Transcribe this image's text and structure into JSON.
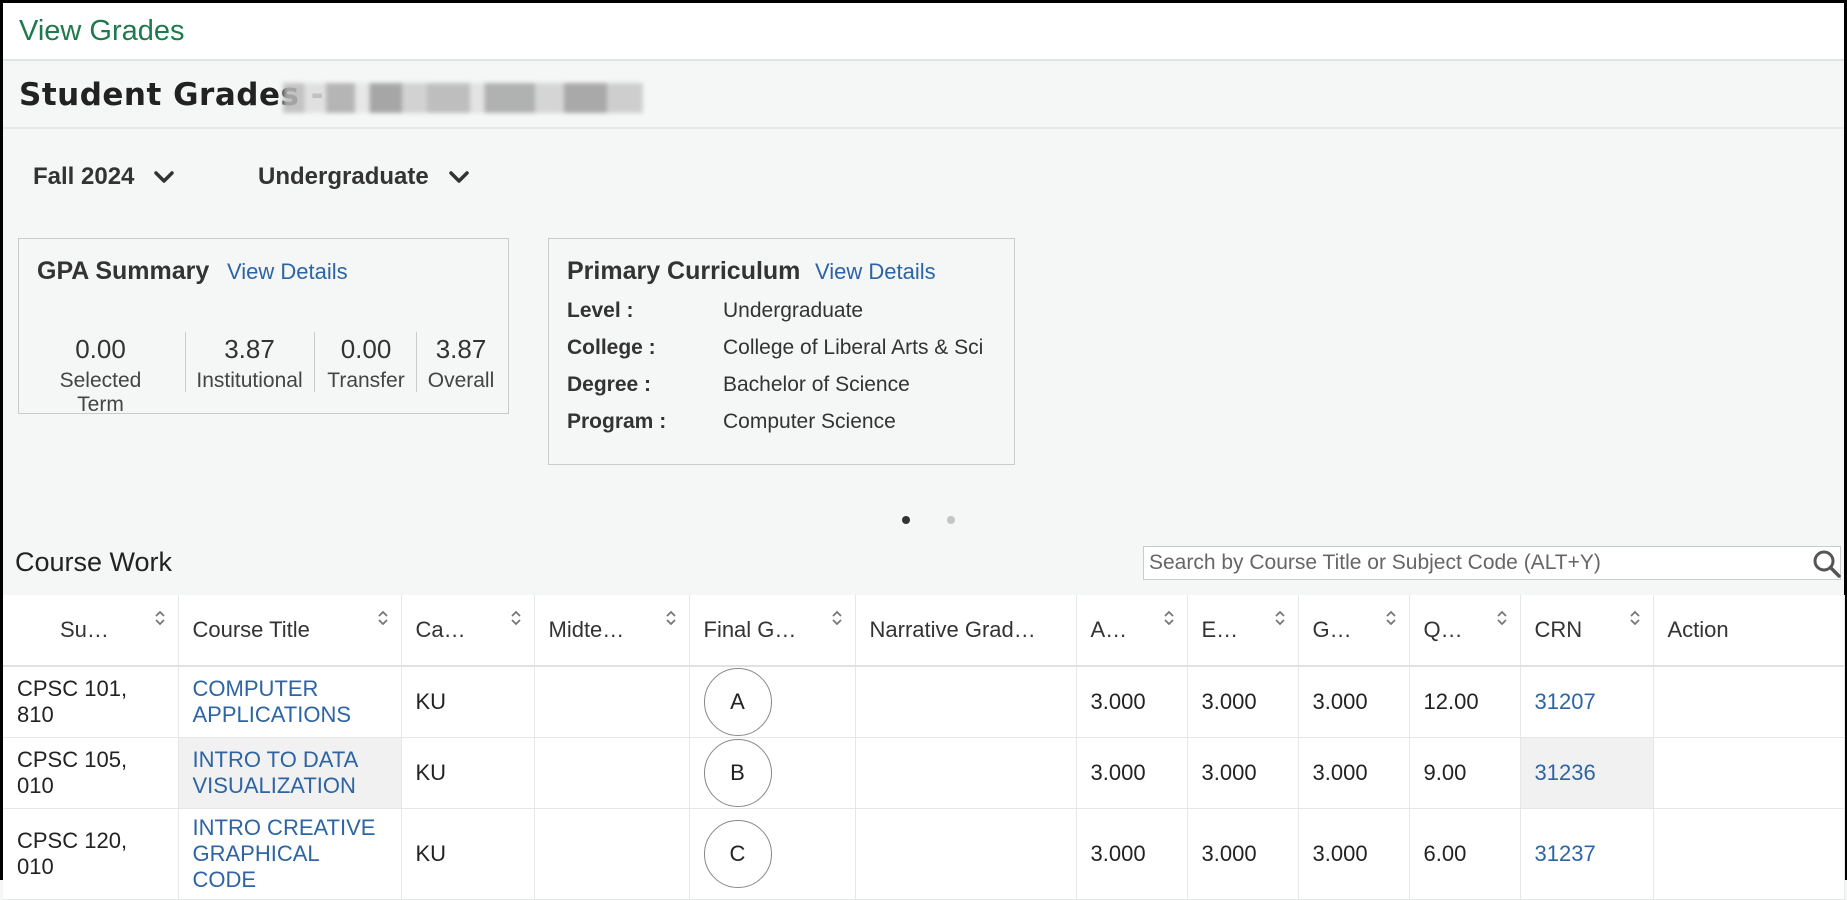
{
  "topbar": {
    "title": "View Grades"
  },
  "header": {
    "title": "Student Grades -"
  },
  "filters": {
    "term": "Fall 2024",
    "level": "Undergraduate"
  },
  "gpa_summary": {
    "title": "GPA Summary",
    "view_details": "View Details",
    "cells": [
      {
        "value": "0.00",
        "label": "Selected Term"
      },
      {
        "value": "3.87",
        "label": "Institutional"
      },
      {
        "value": "0.00",
        "label": "Transfer"
      },
      {
        "value": "3.87",
        "label": "Overall"
      }
    ]
  },
  "curriculum": {
    "title": "Primary Curriculum",
    "view_details": "View Details",
    "rows": [
      {
        "key": "Level :",
        "value": "Undergraduate"
      },
      {
        "key": "College :",
        "value": "College of Liberal Arts & Sci"
      },
      {
        "key": "Degree :",
        "value": "Bachelor of Science"
      },
      {
        "key": "Program :",
        "value": "Computer Science"
      }
    ]
  },
  "carousel": {
    "pages": 2,
    "active": 1,
    "active_color": "#333333",
    "inactive_color": "#c4c4c4"
  },
  "course_work": {
    "title": "Course Work",
    "search_placeholder": "Search by Course Title or Subject Code (ALT+Y)",
    "columns": [
      "Su…",
      "Course Title",
      "Ca…",
      "Midte…",
      "Final G…",
      "Narrative Grad…",
      "A…",
      "E…",
      "G…",
      "Q…",
      "CRN",
      "Action"
    ],
    "rows": [
      {
        "subject": "CPSC 101, 810",
        "title": "COMPUTER APPLICATIONS",
        "campus": "KU",
        "midterm": "",
        "final": "A",
        "narrative": "",
        "attempted": "3.000",
        "earned": "3.000",
        "gpa_hours": "3.000",
        "quality": "12.00",
        "crn": "31207",
        "action": ""
      },
      {
        "subject": "CPSC 105, 010",
        "title": "INTRO TO DATA VISUALIZATION",
        "campus": "KU",
        "midterm": "",
        "final": "B",
        "narrative": "",
        "attempted": "3.000",
        "earned": "3.000",
        "gpa_hours": "3.000",
        "quality": "9.00",
        "crn": "31236",
        "action": ""
      },
      {
        "subject": "CPSC 120, 010",
        "title": "INTRO CREATIVE GRAPHICAL CODE",
        "campus": "KU",
        "midterm": "",
        "final": "C",
        "narrative": "",
        "attempted": "3.000",
        "earned": "3.000",
        "gpa_hours": "3.000",
        "quality": "6.00",
        "crn": "31237",
        "action": ""
      }
    ]
  },
  "colors": {
    "accent_green": "#1e7a4c",
    "link_blue": "#2d64a4"
  }
}
